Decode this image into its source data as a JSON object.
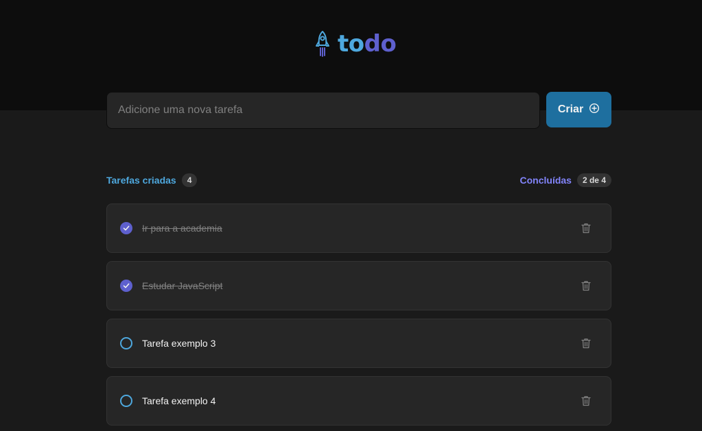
{
  "header": {
    "logo_icon": "rocket-icon",
    "logo_part1": "to",
    "logo_part2": "do",
    "colors": {
      "to": "#4ea8de",
      "do": "#5e60ce"
    }
  },
  "new_task": {
    "placeholder": "Adicione uma nova tarefa",
    "value": "",
    "button_label": "Criar",
    "button_icon": "plus-circle-icon"
  },
  "counters": {
    "created_label": "Tarefas criadas",
    "created_count": "4",
    "done_label": "Concluídas",
    "done_count": "2 de 4"
  },
  "tasks": [
    {
      "text": "Ir para a academia",
      "completed": true
    },
    {
      "text": "Estudar JavaScript",
      "completed": true
    },
    {
      "text": "Tarefa exemplo 3",
      "completed": false
    },
    {
      "text": "Tarefa exemplo 4",
      "completed": false
    }
  ]
}
